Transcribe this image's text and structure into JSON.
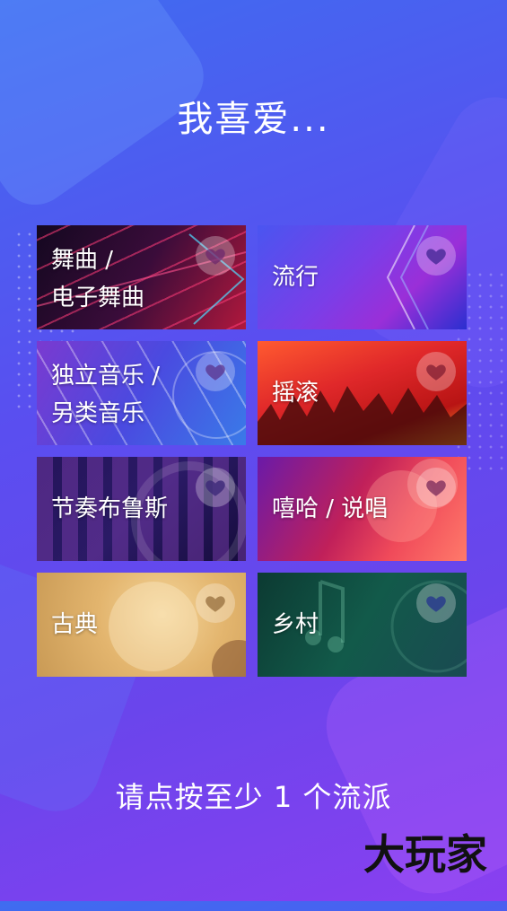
{
  "title": "我喜爱...",
  "genres": [
    {
      "line1": "舞曲 /",
      "line2": "电子舞曲"
    },
    {
      "line1": "流行"
    },
    {
      "line1": "独立音乐 /",
      "line2": "另类音乐"
    },
    {
      "line1": "摇滚"
    },
    {
      "line1": "节奏布鲁斯"
    },
    {
      "line1": "嘻哈 / 说唱"
    },
    {
      "line1": "古典"
    },
    {
      "line1": "乡村"
    }
  ],
  "prompt": "请点按至少 1 个流派",
  "logo": "大玩家"
}
